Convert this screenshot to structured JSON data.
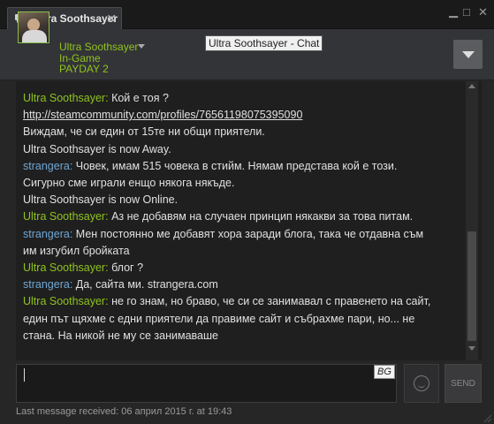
{
  "tab": {
    "label": "Ultra Soothsayer",
    "close": "✕"
  },
  "window_controls": {
    "minimize": "▁",
    "maximize": "□",
    "close": "✕"
  },
  "user": {
    "name": "Ultra Soothsayer",
    "status": "In-Game",
    "game": "PAYDAY 2"
  },
  "tooltip": "Ultra Soothsayer - Chat",
  "messages": [
    {
      "speaker": "Ultra Soothsayer",
      "sep": ": ",
      "text": "Кой е тоя ?"
    },
    {
      "speaker": "",
      "sep": "",
      "link": "http://steamcommunity.com/profiles/76561198075395090"
    },
    {
      "speaker": "",
      "sep": "",
      "text": "Виждам, че си един от 15те ни общи приятели."
    },
    {
      "speaker": "",
      "sep": "",
      "text": "Ultra Soothsayer is now Away."
    },
    {
      "speaker": "strangera",
      "sep": ": ",
      "text": "Човек, имам   515  човека в стийм. Нямам представа кой е този."
    },
    {
      "speaker": "",
      "sep": "",
      "text": "Сигурно сме играли енщо някога някъде."
    },
    {
      "speaker": "",
      "sep": "",
      "text": "Ultra Soothsayer is now Online."
    },
    {
      "speaker": "Ultra Soothsayer",
      "sep": ": ",
      "text": "Аз не добавям на случаен принцип някакви за това питам."
    },
    {
      "speaker": "strangera",
      "sep": ": ",
      "text": "Мен постоянно ме добавят хора заради блога, така че отдавна съм"
    },
    {
      "speaker": "",
      "sep": "",
      "text": "им изгубил бройката"
    },
    {
      "speaker": "Ultra Soothsayer",
      "sep": ": ",
      "text": "блог ?"
    },
    {
      "speaker": "strangera",
      "sep": ": ",
      "text": "Да, сайта ми. strangera.com"
    },
    {
      "speaker": "Ultra Soothsayer",
      "sep": ": ",
      "text": "не го знам, но браво, че си се занимавал с правенето на сайт,"
    },
    {
      "speaker": "",
      "sep": "",
      "text": "един път щяхме с едни приятели да правиме сайт и събрахме пари, но... не"
    },
    {
      "speaker": "",
      "sep": "",
      "text": "стана. На никой не му се занимаваше"
    }
  ],
  "input": {
    "value": "",
    "language_badge": "BG"
  },
  "send_label": "SEND",
  "footer": "Last message received: 06 април 2015 г. at 19:43",
  "colors": {
    "ultra": "#8fc31f",
    "strangera": "#6fa7d6",
    "background": "#262626"
  }
}
